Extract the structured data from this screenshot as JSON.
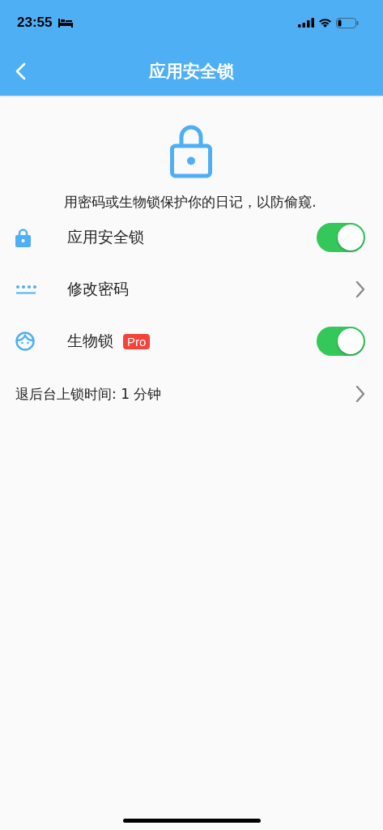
{
  "status_bar": {
    "time": "23:55"
  },
  "nav": {
    "title": "应用安全锁"
  },
  "description": "用密码或生物锁保护你的日记，以防偷窥.",
  "rows": [
    {
      "kind": "toggle",
      "label": "应用安全锁",
      "on": true
    },
    {
      "kind": "link",
      "label": "修改密码"
    },
    {
      "kind": "toggle",
      "label": "生物锁",
      "badge": "Pro",
      "on": true
    }
  ],
  "lock_delay": {
    "label": "退后台上锁时间: 1 分钟"
  }
}
